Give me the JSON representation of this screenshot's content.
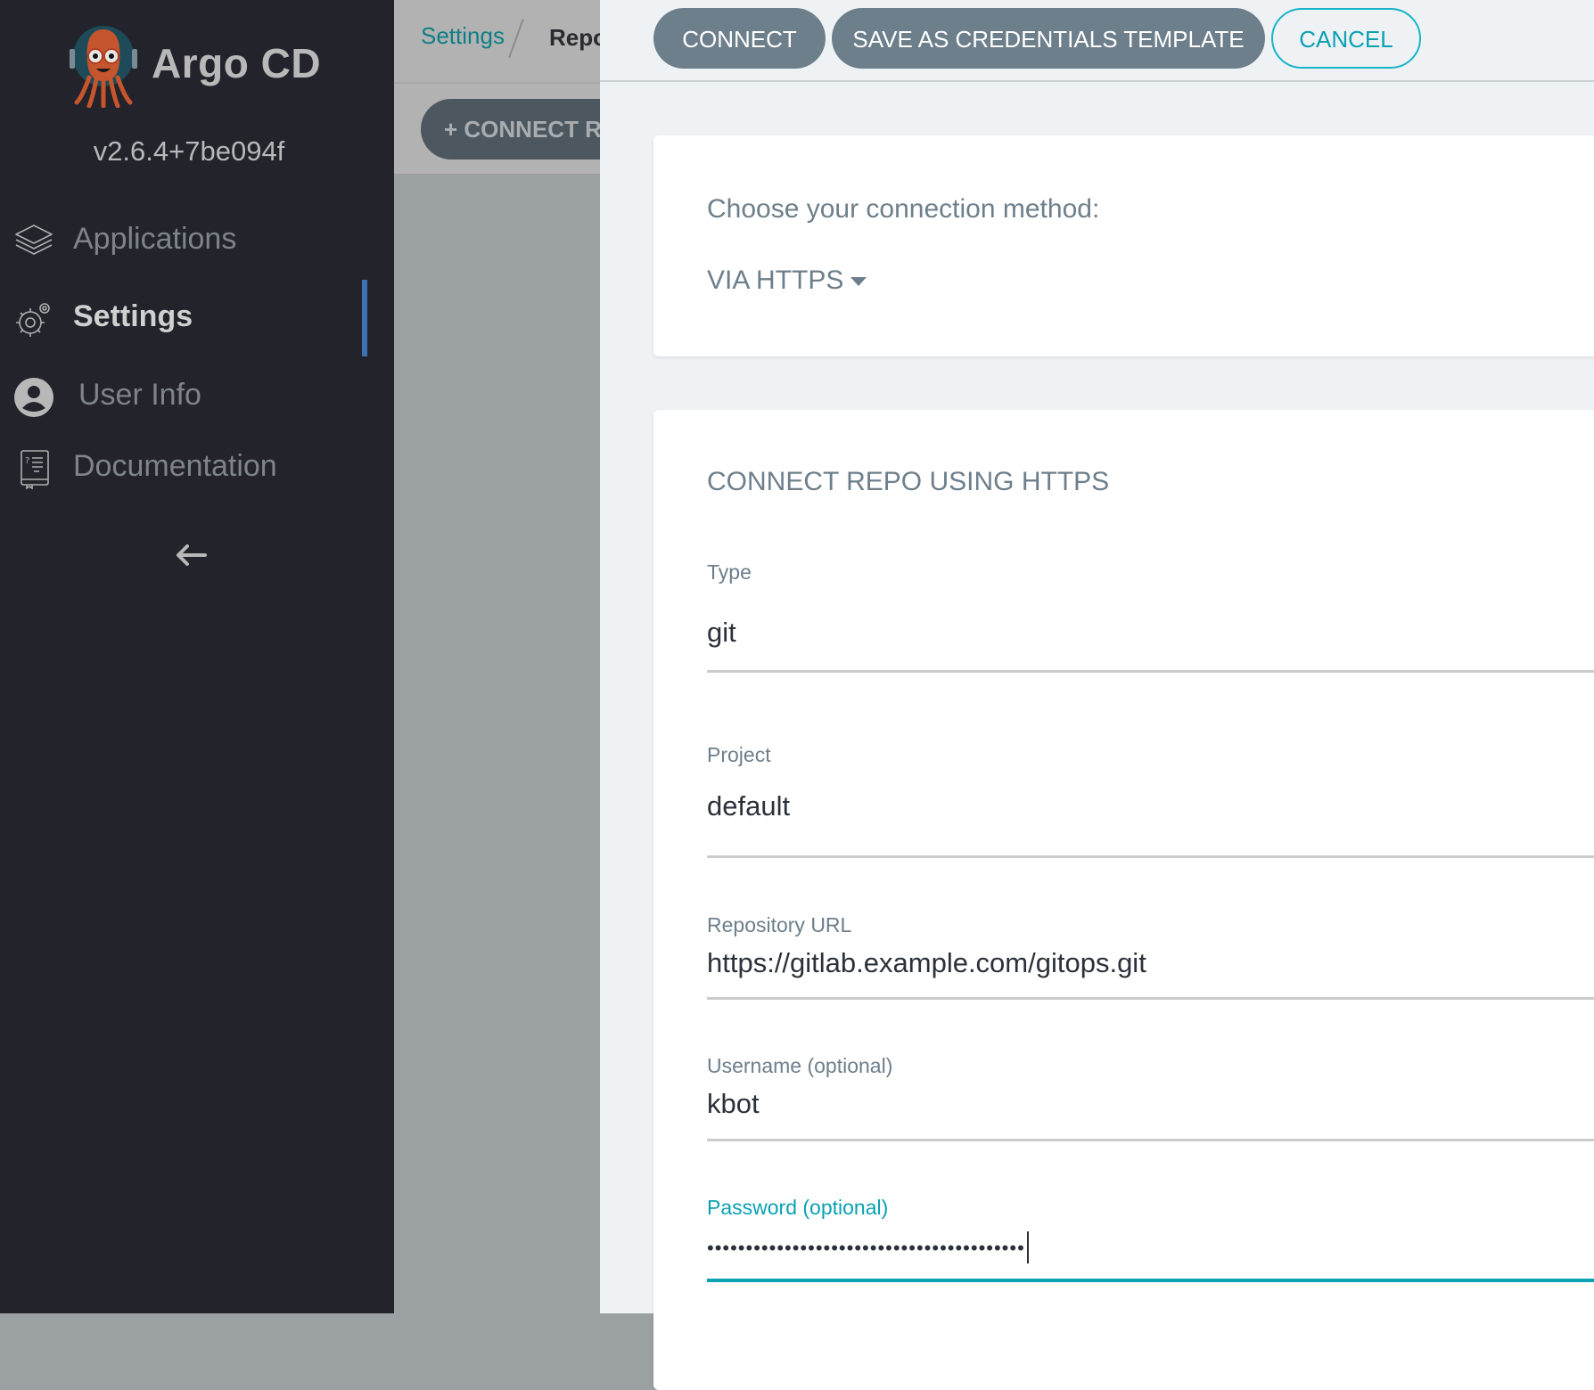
{
  "sidebar": {
    "app_name": "Argo CD",
    "version": "v2.6.4+7be094f",
    "items": [
      {
        "label": "Applications",
        "icon": "layers-icon",
        "active": false
      },
      {
        "label": "Settings",
        "icon": "gear-icon",
        "active": true
      },
      {
        "label": "User Info",
        "icon": "user-circle-icon",
        "active": false
      },
      {
        "label": "Documentation",
        "icon": "book-icon",
        "active": false
      }
    ],
    "collapse_icon": "arrow-left-icon"
  },
  "background_page": {
    "breadcrumb": [
      "Settings",
      "Repo"
    ],
    "connect_repo_button": "+ CONNECT R"
  },
  "panel": {
    "buttons": {
      "connect": "CONNECT",
      "save_template": "SAVE AS CREDENTIALS TEMPLATE",
      "cancel": "CANCEL"
    },
    "connection_method": {
      "label": "Choose your connection method:",
      "selected": "VIA HTTPS"
    },
    "form": {
      "title": "CONNECT REPO USING HTTPS",
      "fields": [
        {
          "label": "Type",
          "value": "git"
        },
        {
          "label": "Project",
          "value": "default"
        },
        {
          "label": "Repository URL",
          "value": "https://gitlab.example.com/gitops.git"
        },
        {
          "label": "Username (optional)",
          "value": "kbot"
        },
        {
          "label": "Password (optional)",
          "value": "•••••••••••••••••••••••••••••••••••••••••",
          "focused": true
        }
      ]
    }
  },
  "colors": {
    "accent": "#0aa1b3",
    "primary_button": "#6d7f8b",
    "sidebar_bg": "#22232b",
    "active_indicator": "#3f72b4"
  }
}
